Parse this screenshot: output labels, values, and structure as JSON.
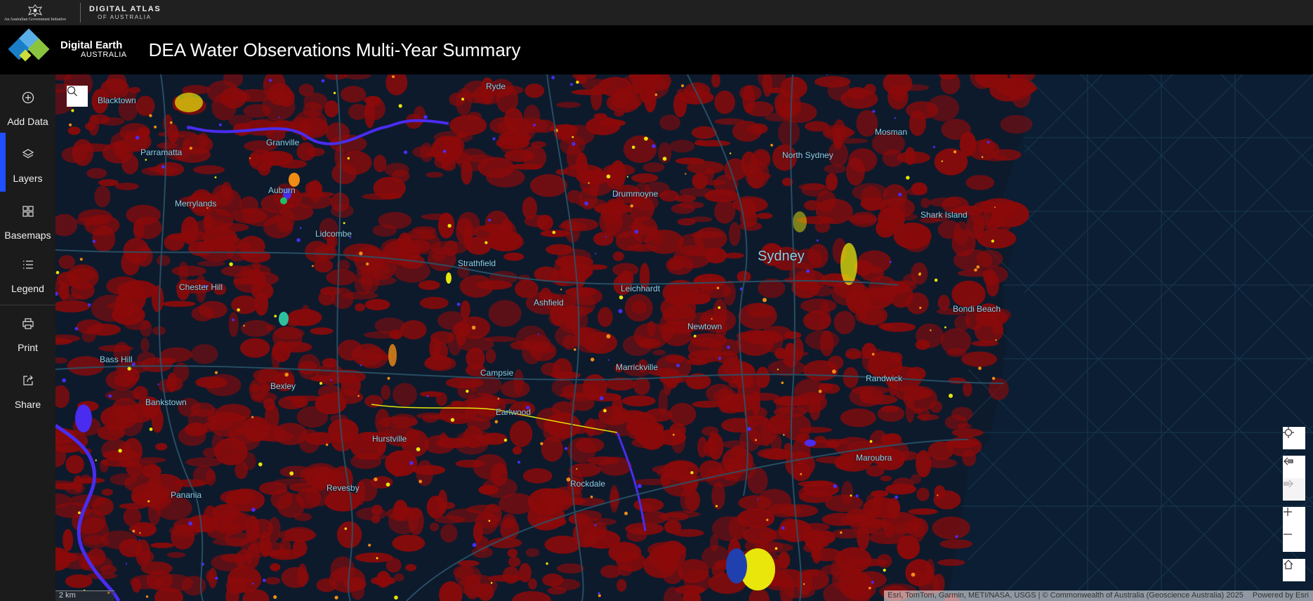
{
  "gov_bar": {
    "crest_text": "An Australian Government Initiative",
    "atlas_line1": "DIGITAL ATLAS",
    "atlas_line2": "OF AUSTRALIA"
  },
  "header": {
    "logo_line1": "Digital Earth",
    "logo_line2": "AUSTRALIA",
    "title": "DEA Water Observations Multi-Year Summary",
    "logo_colors": [
      "#5aaee8",
      "#1a7ec7",
      "#8bc53f",
      "#cddc39"
    ]
  },
  "sidebar": {
    "active": "Layers",
    "accent_color": "#1f4fff",
    "items": [
      {
        "label": "Add Data",
        "icon": "plus-circle-icon"
      },
      {
        "label": "Layers",
        "icon": "layers-icon"
      },
      {
        "label": "Basemaps",
        "icon": "grid-icon"
      },
      {
        "label": "Legend",
        "icon": "list-icon"
      },
      {
        "label": "Print",
        "icon": "printer-icon"
      },
      {
        "label": "Share",
        "icon": "share-icon"
      }
    ]
  },
  "map": {
    "labels": [
      "Ryde",
      "Mosman",
      "North Sydney",
      "Drummoyne",
      "Shark Island",
      "Sydney",
      "Bondi Beach",
      "Leichhardt",
      "Ashfield",
      "Strathfield",
      "Newtown",
      "Marrickville",
      "Campsie",
      "Randwick",
      "Maroubra",
      "Rockdale",
      "Hurstville",
      "Bexley",
      "Bankstown",
      "Chester Hill",
      "Panania",
      "Revesby",
      "Earlwood",
      "Lidcombe",
      "Parramatta",
      "Auburn",
      "Merrylands",
      "Granville",
      "Bass Hill",
      "Blacktown"
    ],
    "search_icon": "search-icon",
    "tools": [
      "locate-icon",
      "previous-extent-icon",
      "next-extent-icon",
      "zoom-in-icon",
      "zoom-out-icon",
      "home-icon"
    ],
    "scale_text": "2 km",
    "attribution": "Esri, TomTom, Garmin, METI/NASA, USGS | © Commonwealth of Australia (Geoscience Australia) 2025",
    "powered_by": "Powered by Esri",
    "colors": {
      "background": "#0d1a2c",
      "ocean": "#0b1e33",
      "roads": "#2a5368",
      "urban_water": "#8c0a0a",
      "frequent_water": "#4a2cf0",
      "medium_water": "#e8e60a",
      "low_water": "#f08c14"
    }
  }
}
